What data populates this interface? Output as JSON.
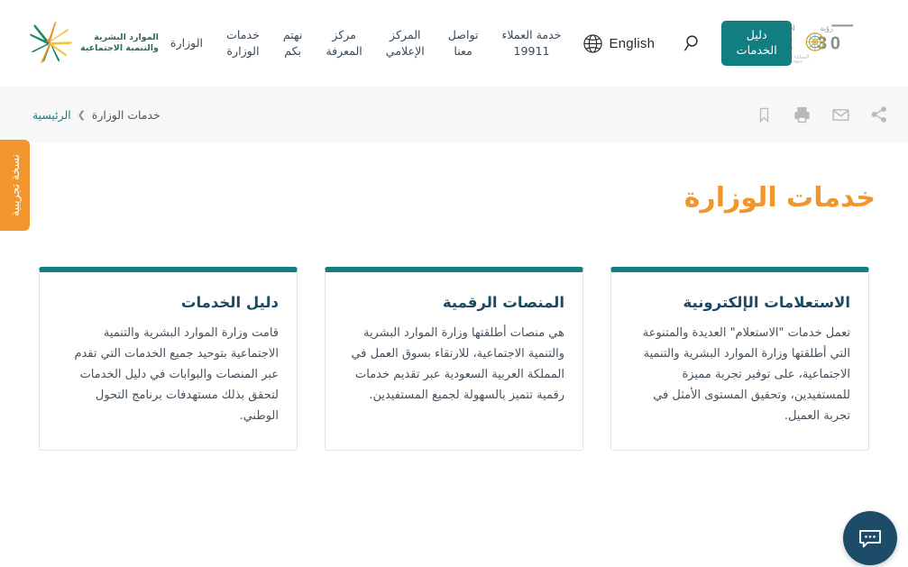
{
  "header": {
    "ministry_logo": {
      "icon": "ministry-star-logo",
      "line1": "الموارد البشرية",
      "line2": "والتنمية الاجتماعية"
    },
    "nav_items": [
      {
        "name": "nav-ministry",
        "label": "الوزارة"
      },
      {
        "name": "nav-ministry-services",
        "label": "خدمات\nالوزارة"
      },
      {
        "name": "nav-we-care",
        "label": "نهتم\nبكم"
      },
      {
        "name": "nav-knowledge-center",
        "label": "مركز\nالمعرفة"
      },
      {
        "name": "nav-media-center",
        "label": "المركز\nالإعلامي"
      },
      {
        "name": "nav-contact-us",
        "label": "تواصل\nمعنا"
      },
      {
        "name": "nav-customer-service",
        "label": "خدمة العملاء\n19911"
      }
    ],
    "language_toggle": {
      "label": "English",
      "icon": "globe-icon"
    },
    "search": {
      "icon": "search-icon"
    },
    "guide_button": {
      "label": "دليل\nالخدمات"
    },
    "vision_logo": {
      "icon": "vision-2030-logo",
      "vision_word": "VISION",
      "arabic_word": "رؤية",
      "number": "2030",
      "kingdom_ar": "المملكة العربية السعودية",
      "kingdom_en": "KINGDOM OF SAUDI ARABIA"
    }
  },
  "breadcrumb": {
    "home": "الرئيسية",
    "separator": "❯",
    "current": "خدمات الوزارة"
  },
  "tools": [
    {
      "name": "bookmark-icon",
      "label": "حفظ"
    },
    {
      "name": "print-icon",
      "label": "طباعة"
    },
    {
      "name": "email-icon",
      "label": "بريد"
    },
    {
      "name": "share-icon",
      "label": "مشاركة"
    }
  ],
  "page": {
    "title": "خدمات الوزارة"
  },
  "cards": [
    {
      "name": "card-services-guide",
      "title": "دليل الخدمات",
      "body": "قامت وزارة الموارد البشرية والتنمية الاجتماعية بتوحيد جميع الخدمات التي تقدم عبر المنصات والبوابات في دليل الخدمات لتحقق بذلك مستهدفات برنامج التحول الوطني."
    },
    {
      "name": "card-digital-platforms",
      "title": "المنصات الرقمية",
      "body": "هي منصات أطلقتها وزارة الموارد البشرية والتنمية الاجتماعية، للارتقاء بسوق العمل في المملكة العربية السعودية عبر تقديم خدمات رقمية تتميز بالسهولة لجميع المستفيدين."
    },
    {
      "name": "card-electronic-inquiries",
      "title": "الاستعلامات الإلكترونية",
      "body": "تعمل خدمات \"الاستعلام\" العديدة والمتنوعة التي أطلقتها وزارة الموارد البشرية والتنمية الاجتماعية، على توفير تجربة مميزة للمستفيدين، وتحقيق المستوى الأمثل في تجربة العميل."
    }
  ],
  "beta_tab": {
    "label": "نسخة تجريبية"
  },
  "chat_fab": {
    "icon": "chat-bubble-icon"
  },
  "colors": {
    "teal": "#137e82",
    "orange": "#f0962c",
    "navy": "#1c4c68",
    "card_title": "#1d4a63",
    "band": "#f7f7f7"
  }
}
